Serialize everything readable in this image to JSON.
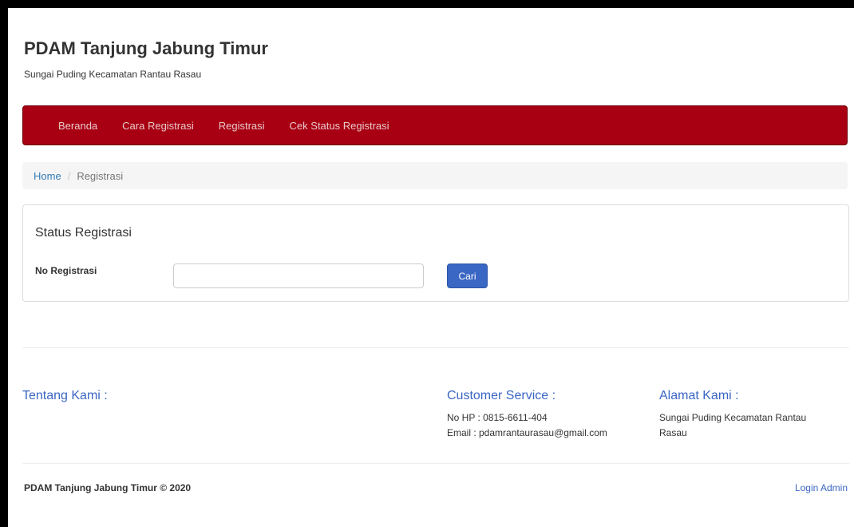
{
  "header": {
    "title": "PDAM Tanjung Jabung Timur",
    "subtitle": "Sungai Puding Kecamatan Rantau Rasau"
  },
  "nav": {
    "items": [
      "Beranda",
      "Cara Registrasi",
      "Registrasi",
      "Cek Status Registrasi"
    ]
  },
  "breadcrumb": {
    "home": "Home",
    "separator": "/",
    "current": "Registrasi"
  },
  "status_panel": {
    "title": "Status Registrasi",
    "field_label": "No Registrasi",
    "field_value": "",
    "button_label": "Cari"
  },
  "footer": {
    "about": {
      "heading": "Tentang Kami :"
    },
    "customer_service": {
      "heading": "Customer Service :",
      "phone": "No HP : 0815-6611-404",
      "email": "Email : pdamrantaurasau@gmail.com"
    },
    "address": {
      "heading": "Alamat Kami :",
      "line1": "Sungai Puding Kecamatan Rantau",
      "line2": "Rasau"
    },
    "copyright": "PDAM Tanjung Jabung Timur © 2020",
    "login_label": "Login Admin"
  },
  "colors": {
    "navbar": "#a80012",
    "link": "#3a66c4",
    "button": "#3a66c4"
  }
}
